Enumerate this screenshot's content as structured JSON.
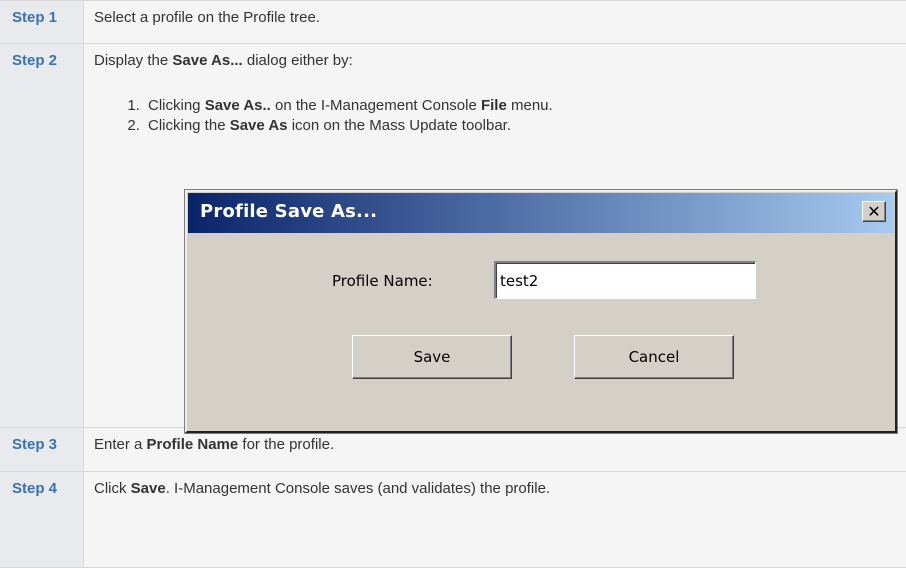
{
  "steps": [
    {
      "label": "Step 1",
      "text": "Select a profile on the Profile tree."
    },
    {
      "label": "Step 2",
      "intro_prefix": "Display the ",
      "intro_bold": "Save As...",
      "intro_suffix": " dialog either by:",
      "substeps": [
        {
          "prefix": "Clicking ",
          "bold1": "Save As..",
          "middle": " on the I-Management Console ",
          "bold2": "File",
          "suffix": " menu."
        },
        {
          "prefix": "Clicking the ",
          "bold1": "Save As",
          "suffix": " icon on the Mass Update toolbar."
        }
      ]
    },
    {
      "label": "Step 3",
      "prefix": "Enter a ",
      "bold": "Profile Name",
      "suffix": " for the profile."
    },
    {
      "label": "Step 4",
      "prefix": "Click ",
      "bold": "Save",
      "suffix": ". I-Management Console saves (and validates) the profile."
    }
  ],
  "dialog": {
    "title": "Profile Save As...",
    "close_glyph": "✕",
    "field_label": "Profile Name:",
    "field_value": "test2",
    "save_label": "Save",
    "cancel_label": "Cancel"
  }
}
